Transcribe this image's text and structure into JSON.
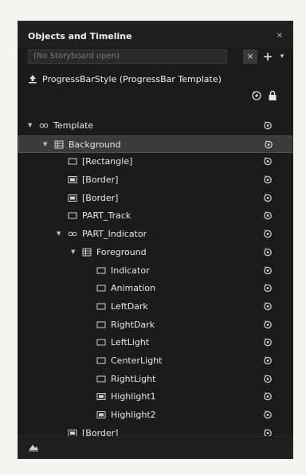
{
  "panel": {
    "title": "Objects and Timeline",
    "close": "×",
    "storyboard": {
      "value": "(No Storyboard open)",
      "close_button": "×",
      "add_button": "+",
      "dropdown_button": "▾"
    },
    "scope_label": "ProgressBarStyle (ProgressBar Template)"
  },
  "tree": [
    {
      "label": "Template",
      "depth": 0,
      "arrow": "down",
      "icon": "template-icon"
    },
    {
      "label": "Background",
      "depth": 1,
      "arrow": "down",
      "icon": "grid-icon",
      "selected": true
    },
    {
      "label": "[Rectangle]",
      "depth": 2,
      "arrow": "none",
      "icon": "rectangle-icon"
    },
    {
      "label": "[Border]",
      "depth": 2,
      "arrow": "none",
      "icon": "border-icon"
    },
    {
      "label": "[Border]",
      "depth": 2,
      "arrow": "none",
      "icon": "border-icon"
    },
    {
      "label": "PART_Track",
      "depth": 2,
      "arrow": "none",
      "icon": "rectangle-icon"
    },
    {
      "label": "PART_Indicator",
      "depth": 2,
      "arrow": "down",
      "icon": "template-icon"
    },
    {
      "label": "Foreground",
      "depth": 3,
      "arrow": "down",
      "icon": "grid-icon"
    },
    {
      "label": "Indicator",
      "depth": 4,
      "arrow": "none",
      "icon": "rectangle-icon"
    },
    {
      "label": "Animation",
      "depth": 4,
      "arrow": "none",
      "icon": "rectangle-icon"
    },
    {
      "label": "LeftDark",
      "depth": 4,
      "arrow": "none",
      "icon": "rectangle-icon"
    },
    {
      "label": "RightDark",
      "depth": 4,
      "arrow": "none",
      "icon": "rectangle-icon"
    },
    {
      "label": "LeftLight",
      "depth": 4,
      "arrow": "none",
      "icon": "rectangle-icon"
    },
    {
      "label": "CenterLight",
      "depth": 4,
      "arrow": "none",
      "icon": "rectangle-icon"
    },
    {
      "label": "RightLight",
      "depth": 4,
      "arrow": "none",
      "icon": "rectangle-icon"
    },
    {
      "label": "Highlight1",
      "depth": 4,
      "arrow": "none",
      "icon": "border-icon"
    },
    {
      "label": "Highlight2",
      "depth": 4,
      "arrow": "none",
      "icon": "border-icon"
    },
    {
      "label": "[Border]",
      "depth": 2,
      "arrow": "none",
      "icon": "border-icon"
    }
  ],
  "colors": {
    "panel_bg": "#1b1b1b",
    "selected_row": "#3b3b3b",
    "text": "#e8e8e8"
  }
}
